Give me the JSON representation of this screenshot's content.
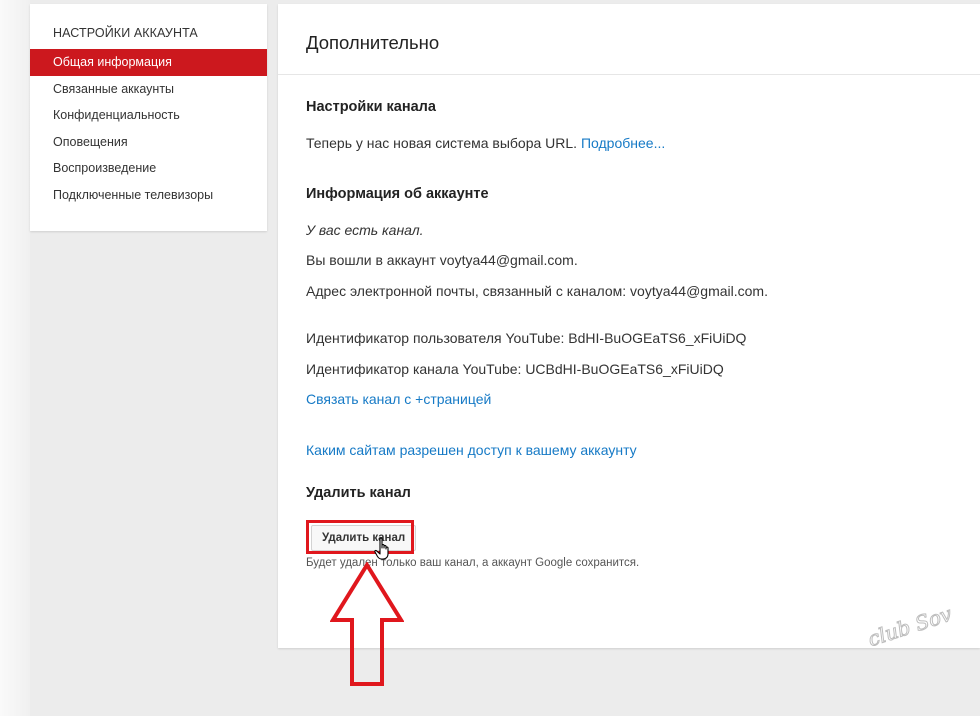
{
  "sidebar": {
    "heading": "НАСТРОЙКИ АККАУНТА",
    "items": [
      {
        "label": "Общая информация",
        "active": true
      },
      {
        "label": "Связанные аккаунты",
        "active": false
      },
      {
        "label": "Конфиденциальность",
        "active": false
      },
      {
        "label": "Оповещения",
        "active": false
      },
      {
        "label": "Воспроизведение",
        "active": false
      },
      {
        "label": "Подключенные телевизоры",
        "active": false
      }
    ]
  },
  "main": {
    "title": "Дополнительно",
    "channel_settings": {
      "title": "Настройки канала",
      "text": "Теперь у нас новая система выбора URL.",
      "link": "Подробнее..."
    },
    "account_info": {
      "title": "Информация об аккаунте",
      "has_channel": "У вас есть канал.",
      "signed_in": "Вы вошли в аккаунт voytya44@gmail.com.",
      "email": "Адрес электронной почты, связанный с каналом: voytya44@gmail.com.",
      "user_id": "Идентификатор пользователя YouTube: BdHI-BuOGEaTS6_xFiUiDQ",
      "channel_id": "Идентификатор канала YouTube: UCBdHI-BuOGEaTS6_xFiUiDQ",
      "link_page": "Связать канал с +страницей",
      "sites_access": "Каким сайтам разрешен доступ к вашему аккаунту"
    },
    "delete_channel": {
      "title": "Удалить канал",
      "button": "Удалить канал",
      "note": "Будет удален только ваш канал, а аккаунт Google сохранится."
    }
  },
  "watermark": {
    "text": "club Sovet"
  },
  "colors": {
    "accent": "#cc181e",
    "link": "#167ac6",
    "highlight": "#e0171d"
  }
}
